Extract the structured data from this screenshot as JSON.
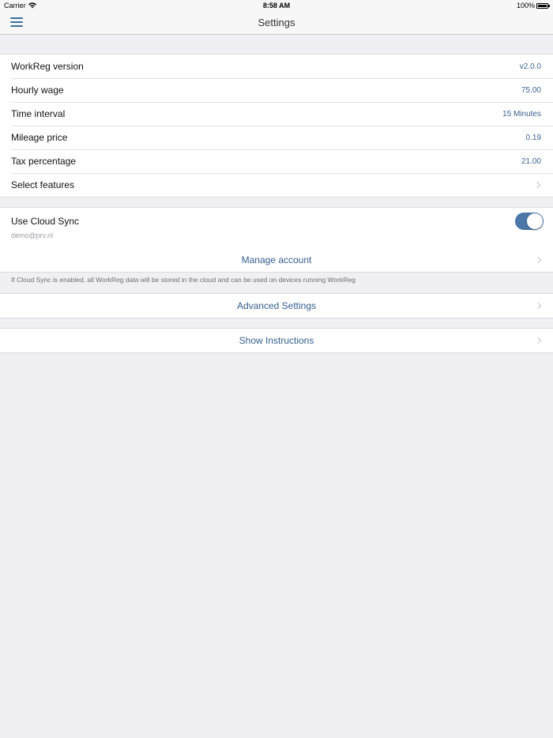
{
  "status_bar": {
    "carrier": "Carrier",
    "time": "8:58 AM",
    "battery": "100%"
  },
  "nav": {
    "title": "Settings"
  },
  "settings": {
    "rows": [
      {
        "label": "WorkReg version",
        "value": "v2.0.0"
      },
      {
        "label": "Hourly wage",
        "value": "75.00"
      },
      {
        "label": "Time interval",
        "value": "15 Minutes"
      },
      {
        "label": "Mileage price",
        "value": "0.19"
      },
      {
        "label": "Tax percentage",
        "value": "21.00"
      },
      {
        "label": "Select features",
        "value": ""
      }
    ]
  },
  "cloud": {
    "label": "Use Cloud Sync",
    "email": "demo@prv.nl",
    "enabled": true,
    "toggle_color": "#4a76a8",
    "manage_label": "Manage account",
    "note": "If Cloud Sync is enabled, all WorkReg data will be stored in the cloud and can be used on devices running WorkReg"
  },
  "advanced": {
    "label": "Advanced Settings"
  },
  "instructions": {
    "label": "Show Instructions"
  },
  "colors": {
    "accent": "#3d6290",
    "background": "#efeff4"
  }
}
